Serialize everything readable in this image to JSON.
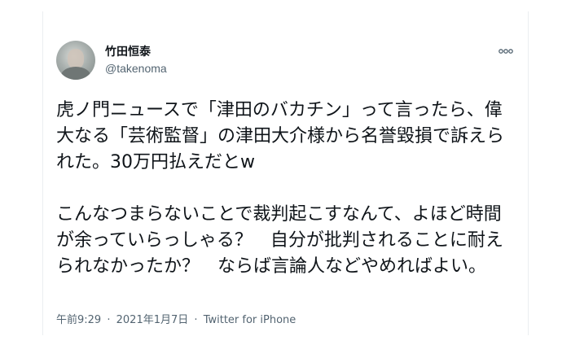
{
  "tweet": {
    "display_name": "竹田恒泰",
    "handle": "@takenoma",
    "avatar_icon": "user-avatar",
    "more_icon": "more-dots-icon",
    "text": "虎ノ門ニュースで「津田のバカチン」って言ったら、偉大なる「芸術監督」の津田大介様から名誉毀損で訴えられた。30万円払えだとw\n\nこんなつまらないことで裁判起こすなんて、よほど時間が余っていらっしゃる？　自分が批判されることに耐えられなかったか？　ならば言論人などやめればよい。",
    "time": "午前9:29",
    "separator": "·",
    "date": "2021年1月7日",
    "source": "Twitter for iPhone"
  }
}
